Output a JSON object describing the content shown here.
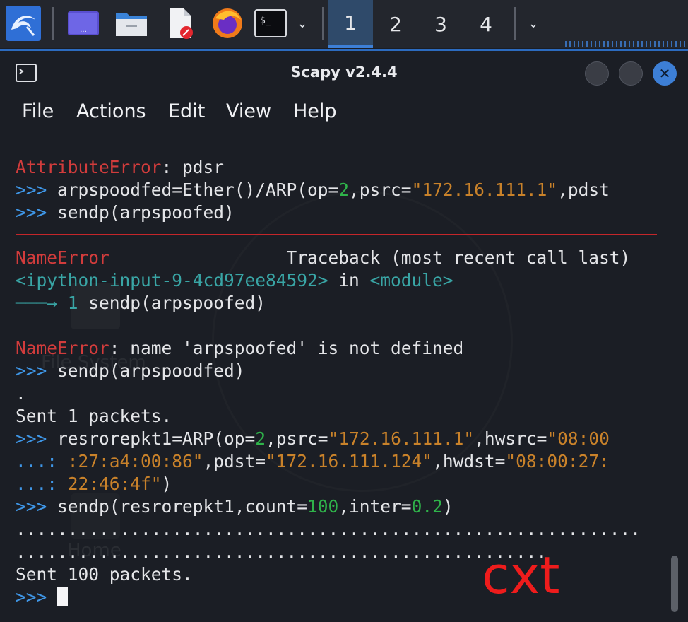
{
  "panel": {
    "workspaces": [
      "1",
      "2",
      "3",
      "4"
    ],
    "icons": [
      "kali-menu-icon",
      "show-desktop-icon",
      "file-manager-icon",
      "text-editor-icon",
      "firefox-icon",
      "terminal-icon"
    ],
    "accent": "#3d7fd6"
  },
  "window": {
    "title": "Scapy v2.4.4",
    "menu": [
      "File",
      "Actions",
      "Edit",
      "View",
      "Help"
    ]
  },
  "terminal": {
    "lines": {
      "l1": {
        "err": "AttributeError",
        "rest": ": pdsr"
      },
      "l2": {
        "prompt": ">>>",
        "a": " arpspoodfed=Ether()/ARP(op=",
        "b": "2",
        "c": ",psrc=",
        "d": "\"172.16.111.1\"",
        "e": ",pdst"
      },
      "l3": {
        "prompt": ">>>",
        "a": " sendp(arpspoofed)"
      },
      "l4": {
        "err": "NameError",
        "tb": "                 Traceback (most recent call last)"
      },
      "l5": {
        "a": "<ipython-input-9-4cd97ee84592>",
        "b": " in ",
        "c": "<module>"
      },
      "l6": {
        "arrow": "───→",
        "a": " 1 ",
        "b": "sendp(arpspoofed)"
      },
      "l7": {
        "err": "NameError",
        "rest": ": name 'arpspoofed' is not defined"
      },
      "l8": {
        "prompt": ">>>",
        "a": " sendp(arpspoodfed)"
      },
      "l9": {
        "a": "."
      },
      "l10": {
        "a": "Sent 1 packets."
      },
      "l11": {
        "prompt": ">>>",
        "a": " resrorepkt1=ARP(op=",
        "b": "2",
        "c": ",psrc=",
        "d": "\"172.16.111.1\"",
        "e": ",hwsrc=",
        "f": "\"08:00"
      },
      "l12": {
        "prompt": "...:",
        "a": " :27:a4:00:86\"",
        "b": ",pdst=",
        "c": "\"172.16.111.124\"",
        "d": ",hwdst=",
        "e": "\"08:00:27:"
      },
      "l13": {
        "prompt": "...:",
        "a": " 22:46:4f\"",
        "b": ")"
      },
      "l14": {
        "prompt": ">>>",
        "a": " sendp(resrorepkt1,count=",
        "b": "100",
        "c": ",inter=",
        "d": "0.2",
        "e": ")"
      },
      "l15": {
        "a": "............................................................"
      },
      "l16": {
        "a": "..................................................."
      },
      "l17": {
        "a": "Sent 100 packets."
      },
      "l18": {
        "prompt": ">>>"
      }
    },
    "background_labels": {
      "file_system": "File System",
      "home": "Home"
    },
    "watermark": "cxt"
  }
}
